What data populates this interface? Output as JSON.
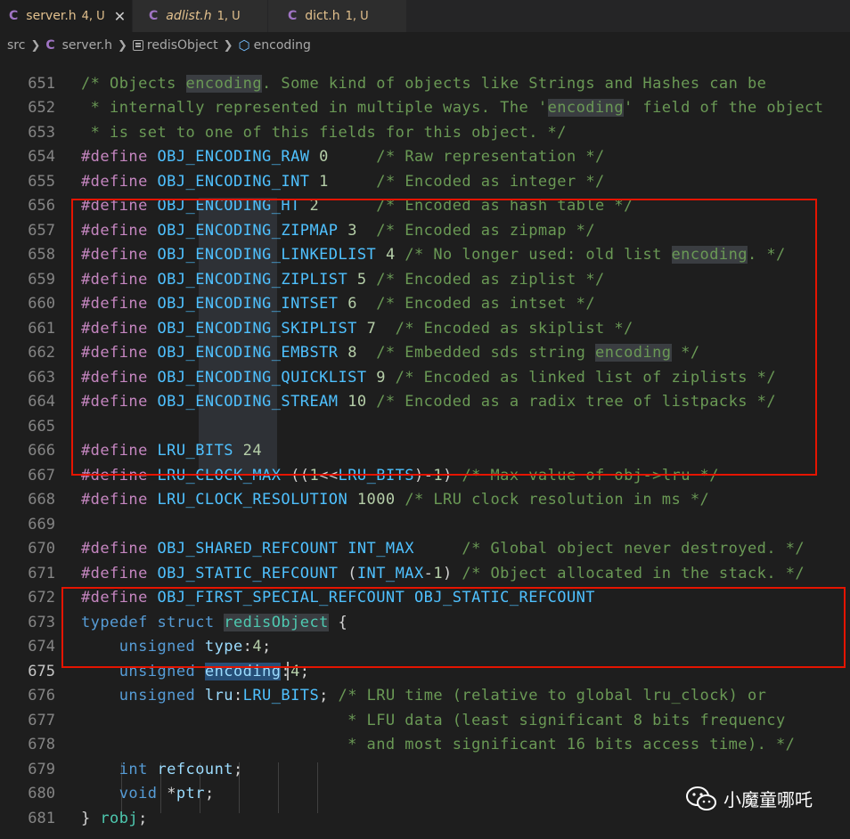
{
  "tabs": [
    {
      "icon": "C",
      "name": "server.h",
      "badge": "4, U",
      "close": "✕",
      "active": true,
      "italic": false
    },
    {
      "icon": "C",
      "name": "adlist.h",
      "badge": "1, U",
      "active": false,
      "italic": true
    },
    {
      "icon": "C",
      "name": "dict.h",
      "badge": "1, U",
      "active": false,
      "italic": false
    }
  ],
  "breadcrumb": {
    "folder": "src",
    "file_icon": "C",
    "file": "server.h",
    "struct": "redisObject",
    "field": "encoding"
  },
  "editor": {
    "current_line": "675",
    "lines": [
      {
        "no": "651",
        "text": "/* Objects encoding. Some kind of objects like Strings and Hashes can be"
      },
      {
        "no": "652",
        "text": " * internally represented in multiple ways. The 'encoding' field of the object"
      },
      {
        "no": "653",
        "text": " * is set to one of this fields for this object. */"
      },
      {
        "no": "654",
        "text": "#define OBJ_ENCODING_RAW 0     /* Raw representation */"
      },
      {
        "no": "655",
        "text": "#define OBJ_ENCODING_INT 1     /* Encoded as integer */"
      },
      {
        "no": "656",
        "text": "#define OBJ_ENCODING_HT 2      /* Encoded as hash table */"
      },
      {
        "no": "657",
        "text": "#define OBJ_ENCODING_ZIPMAP 3  /* Encoded as zipmap */"
      },
      {
        "no": "658",
        "text": "#define OBJ_ENCODING_LINKEDLIST 4 /* No longer used: old list encoding. */"
      },
      {
        "no": "659",
        "text": "#define OBJ_ENCODING_ZIPLIST 5 /* Encoded as ziplist */"
      },
      {
        "no": "660",
        "text": "#define OBJ_ENCODING_INTSET 6  /* Encoded as intset */"
      },
      {
        "no": "661",
        "text": "#define OBJ_ENCODING_SKIPLIST 7  /* Encoded as skiplist */"
      },
      {
        "no": "662",
        "text": "#define OBJ_ENCODING_EMBSTR 8  /* Embedded sds string encoding */"
      },
      {
        "no": "663",
        "text": "#define OBJ_ENCODING_QUICKLIST 9 /* Encoded as linked list of ziplists */"
      },
      {
        "no": "664",
        "text": "#define OBJ_ENCODING_STREAM 10 /* Encoded as a radix tree of listpacks */"
      },
      {
        "no": "665",
        "text": ""
      },
      {
        "no": "666",
        "text": "#define LRU_BITS 24"
      },
      {
        "no": "667",
        "text": "#define LRU_CLOCK_MAX ((1<<LRU_BITS)-1) /* Max value of obj->lru */"
      },
      {
        "no": "668",
        "text": "#define LRU_CLOCK_RESOLUTION 1000 /* LRU clock resolution in ms */"
      },
      {
        "no": "669",
        "text": ""
      },
      {
        "no": "670",
        "text": "#define OBJ_SHARED_REFCOUNT INT_MAX     /* Global object never destroyed. */"
      },
      {
        "no": "671",
        "text": "#define OBJ_STATIC_REFCOUNT (INT_MAX-1) /* Object allocated in the stack. */"
      },
      {
        "no": "672",
        "text": "#define OBJ_FIRST_SPECIAL_REFCOUNT OBJ_STATIC_REFCOUNT"
      },
      {
        "no": "673",
        "text": "typedef struct redisObject {"
      },
      {
        "no": "674",
        "text": "    unsigned type:4;"
      },
      {
        "no": "675",
        "text": "    unsigned encoding:4;"
      },
      {
        "no": "676",
        "text": "    unsigned lru:LRU_BITS; /* LRU time (relative to global lru_clock) or"
      },
      {
        "no": "677",
        "text": "                            * LFU data (least significant 8 bits frequency"
      },
      {
        "no": "678",
        "text": "                            * and most significant 16 bits access time). */"
      },
      {
        "no": "679",
        "text": "    int refcount;"
      },
      {
        "no": "680",
        "text": "    void *ptr;"
      },
      {
        "no": "681",
        "text": "} robj;"
      }
    ]
  },
  "watermark": {
    "text": "小魔童哪吒",
    "icon": "wechat-icon"
  },
  "colors": {
    "background": "#1e1e1e",
    "preprocessor": "#c586c0",
    "macro": "#4fc1ff",
    "number": "#b5cea8",
    "comment": "#6a9955",
    "keyword": "#569cd6",
    "type": "#4ec9b0",
    "variable": "#9cdcfe",
    "annotation_box": "#e51400"
  }
}
